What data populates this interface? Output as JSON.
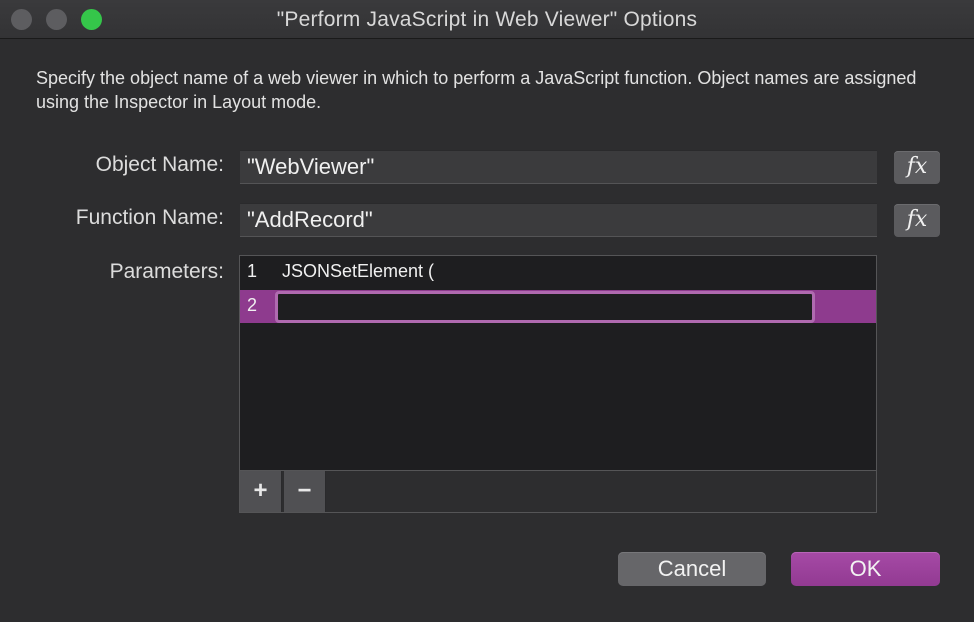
{
  "window": {
    "title": "\"Perform JavaScript in Web Viewer\" Options"
  },
  "description": "Specify the object name of a web viewer in which to perform a JavaScript function. Object names are assigned using the Inspector in Layout mode.",
  "object_name": {
    "label": "Object Name:",
    "value": "\"WebViewer\"",
    "fx_label": "fx"
  },
  "function_name": {
    "label": "Function Name:",
    "value": "\"AddRecord\"",
    "fx_label": "fx"
  },
  "parameters": {
    "label": "Parameters:",
    "rows": [
      {
        "number": "1",
        "value": "JSONSetElement ("
      },
      {
        "number": "2",
        "value": ""
      }
    ],
    "add_label": "+",
    "remove_label": "−"
  },
  "buttons": {
    "cancel": "Cancel",
    "ok": "OK"
  },
  "colors": {
    "accent": "#923a92",
    "selected_row": "#8e3b8e",
    "zoom_button": "#35c64a"
  }
}
